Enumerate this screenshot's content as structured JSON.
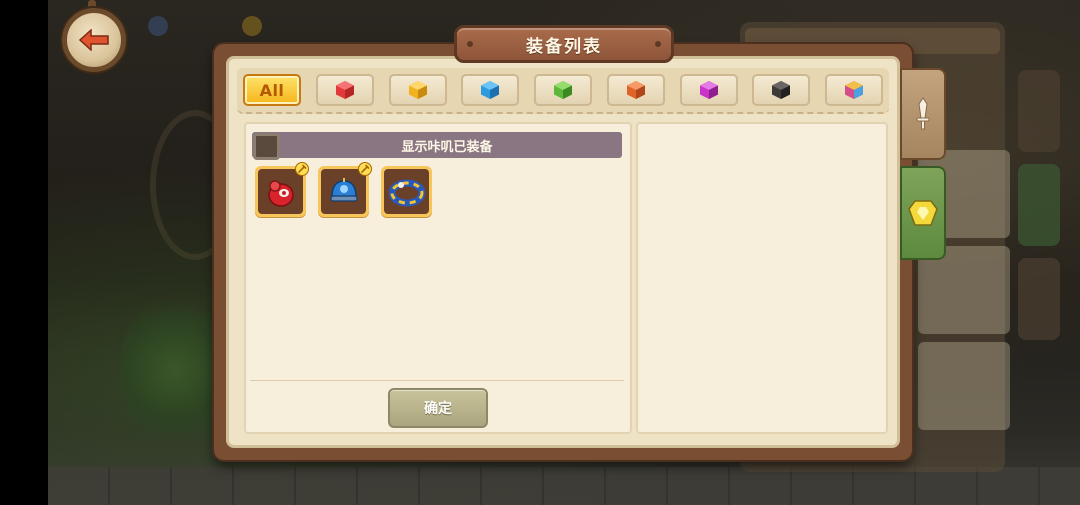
{
  "modal": {
    "title": "装备列表",
    "filter_tabs": [
      {
        "label": "All",
        "active": true,
        "icon": null
      },
      {
        "label": "",
        "active": false,
        "icon": "red-cube-icon",
        "color": "#e23a3a"
      },
      {
        "label": "",
        "active": false,
        "icon": "yellow-cube-icon",
        "color": "#f2b11f"
      },
      {
        "label": "",
        "active": false,
        "icon": "blue-cube-icon",
        "color": "#2e9ae0"
      },
      {
        "label": "",
        "active": false,
        "icon": "green-cube-icon",
        "color": "#5fb83a"
      },
      {
        "label": "",
        "active": false,
        "icon": "orange-cube-icon",
        "color": "#e0642a"
      },
      {
        "label": "",
        "active": false,
        "icon": "purple-cube-icon",
        "color": "#c934c9"
      },
      {
        "label": "",
        "active": false,
        "icon": "black-cube-icon",
        "color": "#3d3a38"
      },
      {
        "label": "",
        "active": false,
        "icon": "rainbow-cube-icon",
        "color": "#e77a4a"
      }
    ],
    "toggle_label": "显示咔叽已装备",
    "toggle_checked": false,
    "items": [
      {
        "name": "red-gauntlet-item",
        "icon": "red-gauntlet-icon",
        "equipped_badge": true
      },
      {
        "name": "blue-helmet-item",
        "icon": "blue-helmet-icon",
        "equipped_badge": true
      },
      {
        "name": "striped-ring-item",
        "icon": "striped-ring-icon",
        "equipped_badge": false
      }
    ],
    "confirm_label": "确定"
  },
  "colors": {
    "active_tab": "#f6b41a",
    "toggle_bar": "#8a7582",
    "confirm_button": "#aaa57e",
    "modal_frame": "#7a4e33"
  }
}
